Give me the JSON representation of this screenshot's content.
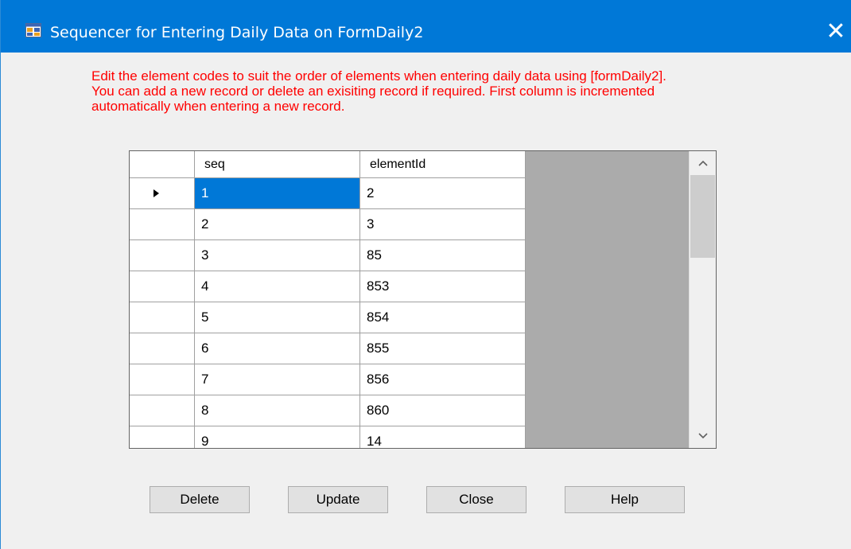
{
  "window": {
    "title": "Sequencer for Entering Daily Data on FormDaily2",
    "close_glyph": "✕",
    "app_icon": "form-app-icon"
  },
  "instructions": {
    "line1": "Edit the element codes  to suit the order of elements when entering daily data using [formDaily2].",
    "line2": "You can add a new record or delete an exisiting record if required. First column is incremented",
    "line3": "automatically when entering a new record."
  },
  "grid": {
    "columns": [
      "seq",
      "elementId"
    ],
    "rows": [
      {
        "seq": "1",
        "elementId": "2"
      },
      {
        "seq": "2",
        "elementId": "3"
      },
      {
        "seq": "3",
        "elementId": "85"
      },
      {
        "seq": "4",
        "elementId": "853"
      },
      {
        "seq": "5",
        "elementId": "854"
      },
      {
        "seq": "6",
        "elementId": "855"
      },
      {
        "seq": "7",
        "elementId": "856"
      },
      {
        "seq": "8",
        "elementId": "860"
      },
      {
        "seq": "9",
        "elementId": "14"
      }
    ],
    "selected_row": 0
  },
  "buttons": {
    "delete": "Delete",
    "update": "Update",
    "close": "Close",
    "help": "Help"
  },
  "colors": {
    "titlebar": "#0078d7",
    "instructions_text": "#ff0000",
    "selection": "#0078d7",
    "grid_background": "#ababab"
  }
}
